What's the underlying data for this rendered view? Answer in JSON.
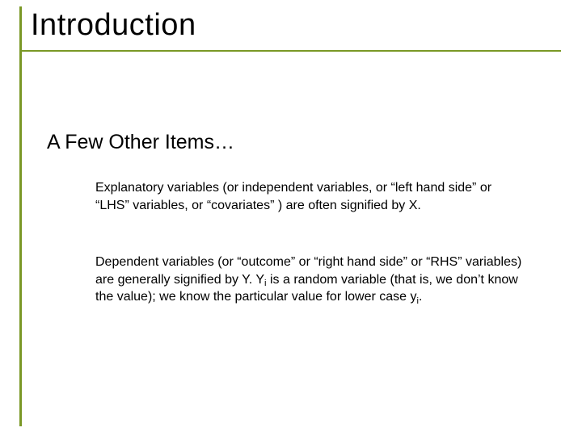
{
  "title": "Introduction",
  "subtitle": "A Few Other Items…",
  "paragraph1": "Explanatory variables (or independent variables, or “left hand side” or “LHS” variables, or “covariates” ) are often signified by X.",
  "paragraph2_part1": "Dependent variables (or “outcome” or “right hand side” or “RHS” variables) are generally signified by Y. Y",
  "paragraph2_sub1": "i",
  "paragraph2_part2": " is a random variable (that is, we don’t know the value); we know the particular value for lower case y",
  "paragraph2_sub2": "i",
  "paragraph2_part3": "."
}
